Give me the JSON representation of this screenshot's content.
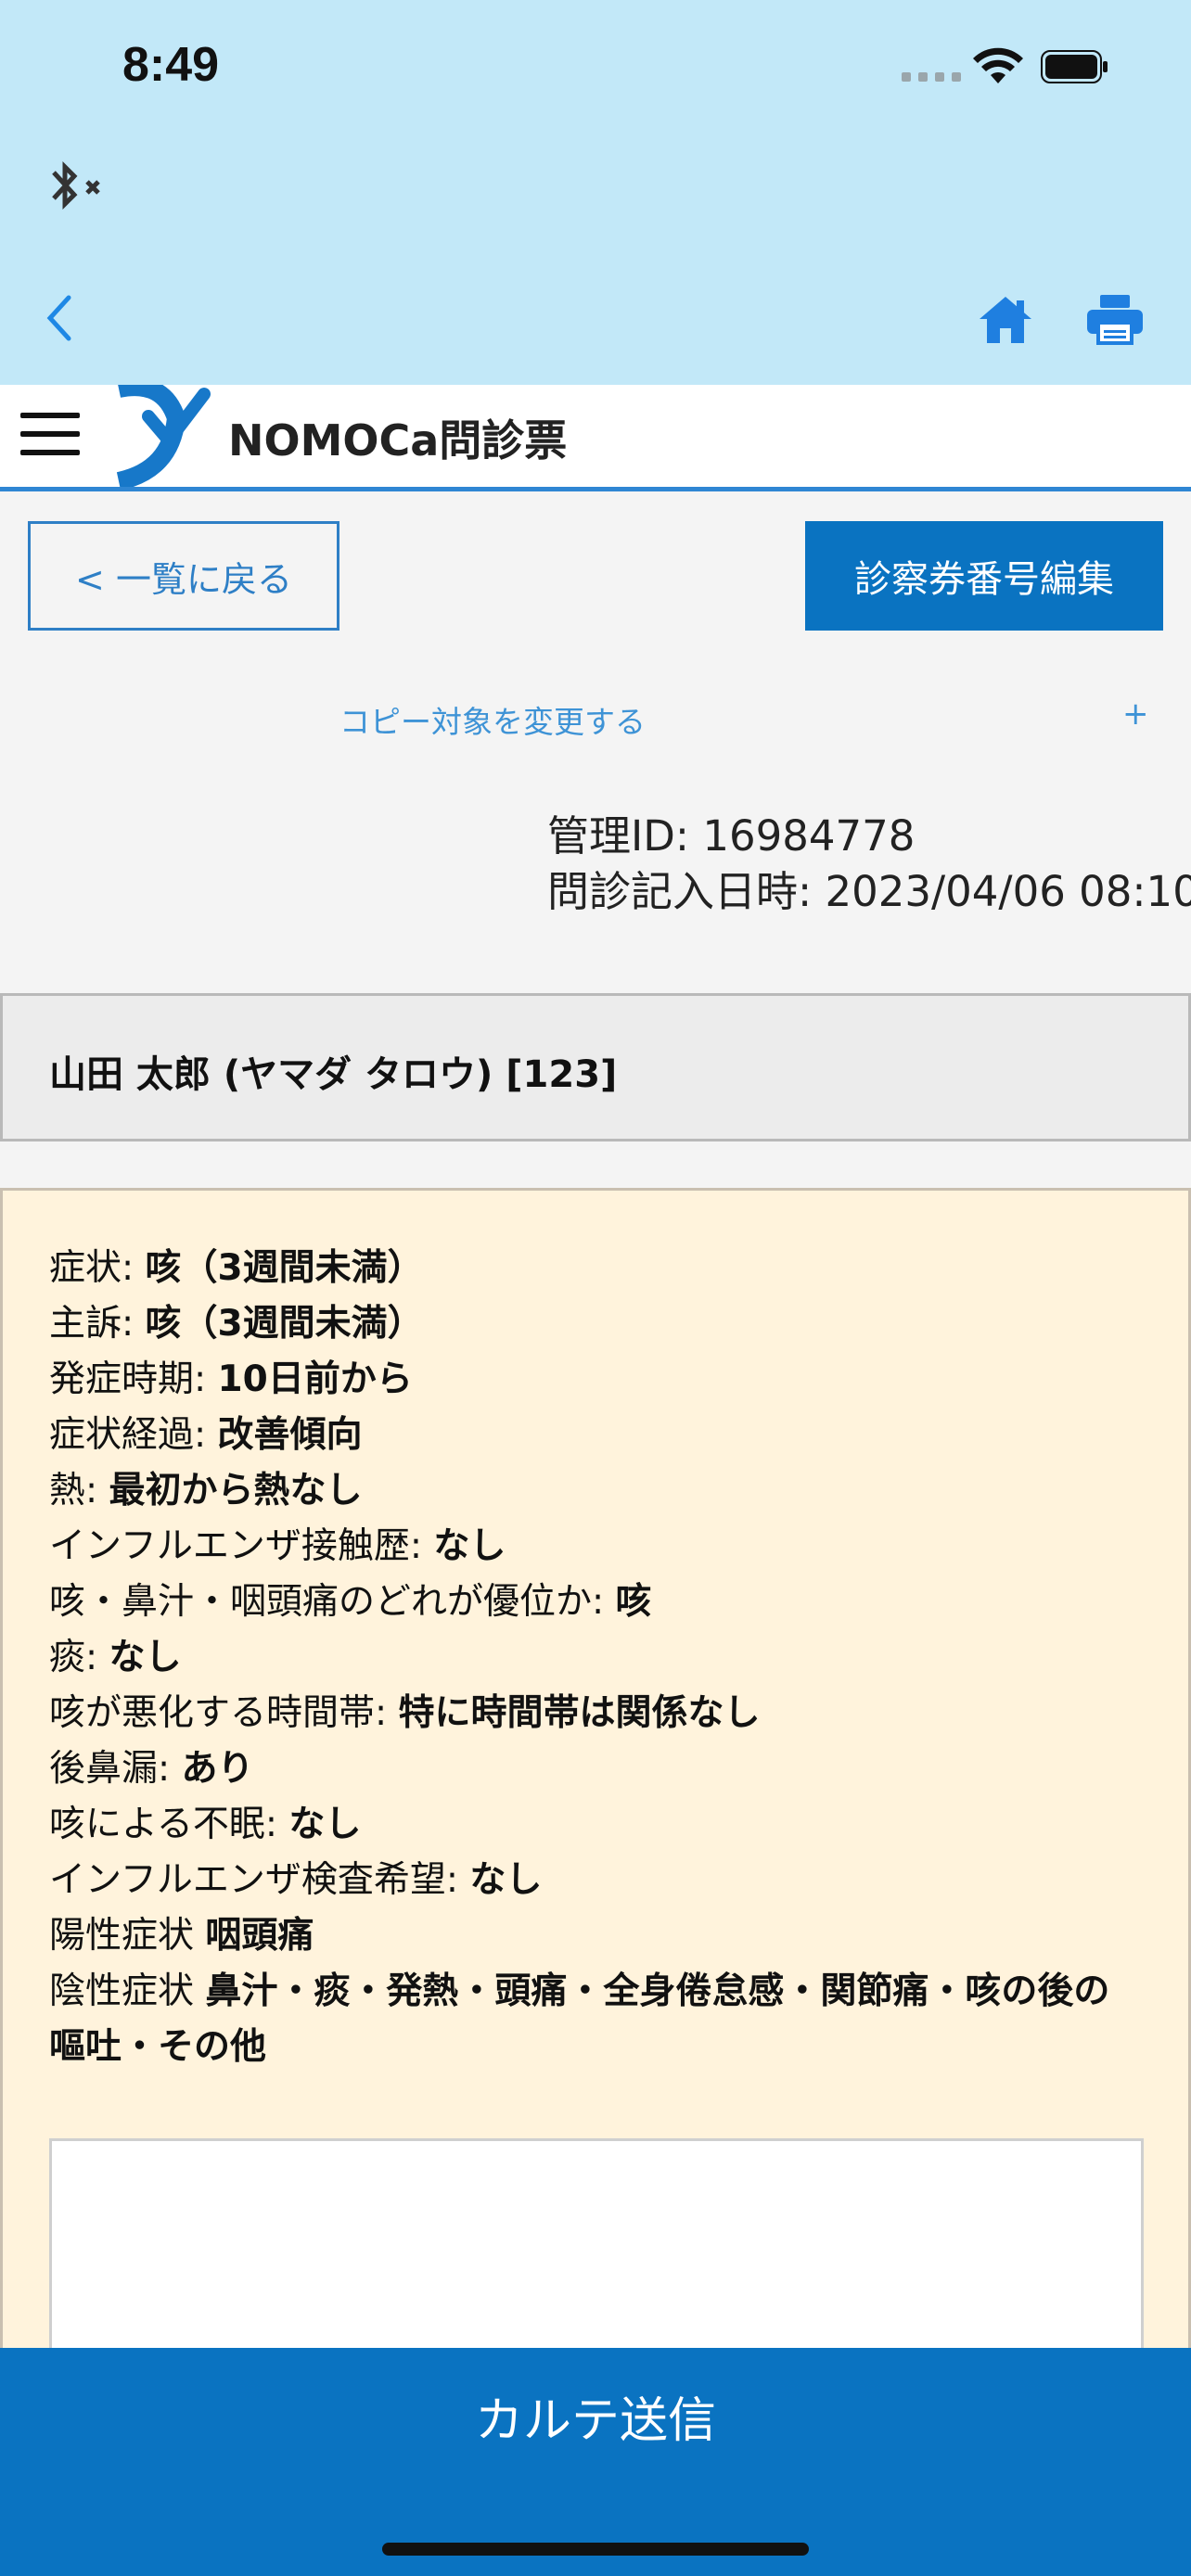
{
  "status_bar": {
    "time": "8:49"
  },
  "nav": {
    "back_icon": "chevron-left-icon",
    "home_icon": "home-icon",
    "print_icon": "printer-icon"
  },
  "header": {
    "title": "NOMOCa問診票"
  },
  "actions": {
    "back_to_list": "< 一覧に戻る",
    "edit_card_number": "診察券番号編集"
  },
  "copy": {
    "change_target": "コピー対象を変更する",
    "expand": "+"
  },
  "meta": {
    "management_id": "管理ID: 16984778",
    "entry_datetime": "問診記入日時: 2023/04/06 08:10"
  },
  "patient": {
    "name": "山田 太郎 (ヤマダ タロウ) [123]"
  },
  "questionnaire": [
    {
      "label": "症状: ",
      "value": "咳（3週間未満）"
    },
    {
      "label": "主訴: ",
      "value": "咳（3週間未満）"
    },
    {
      "label": "発症時期: ",
      "value": "10日前から"
    },
    {
      "label": "症状経過: ",
      "value": "改善傾向"
    },
    {
      "label": "熱: ",
      "value": "最初から熱なし"
    },
    {
      "label": "インフルエンザ接触歴: ",
      "value": "なし"
    },
    {
      "label": "咳・鼻汁・咽頭痛のどれが優位か: ",
      "value": "咳"
    },
    {
      "label": "痰: ",
      "value": "なし"
    },
    {
      "label": "咳が悪化する時間帯: ",
      "value": "特に時間帯は関係なし"
    },
    {
      "label": "後鼻漏: ",
      "value": "あり"
    },
    {
      "label": "咳による不眠: ",
      "value": "なし"
    },
    {
      "label": "インフルエンザ検査希望: ",
      "value": "なし"
    },
    {
      "label": "陽性症状 ",
      "value": "咽頭痛"
    },
    {
      "label": "陰性症状 ",
      "value": "鼻汁・痰・発熱・頭痛・全身倦怠感・関節痛・咳の後の嘔吐・その他"
    }
  ],
  "footer": {
    "send_label": "カルテ送信"
  },
  "colors": {
    "status_bg": "#c2e8f8",
    "accent": "#0a73c1",
    "content_bg": "#fff3dc"
  }
}
